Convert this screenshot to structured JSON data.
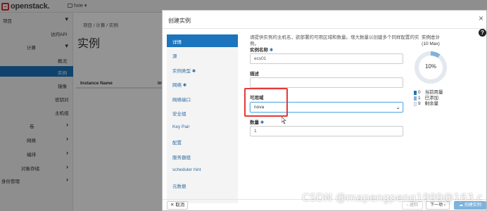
{
  "app": {
    "logo_text": "openstack.",
    "project_selector": "hxie",
    "project_caret": "▾"
  },
  "sidebar": {
    "items": [
      {
        "label": "项目",
        "chev": "▾"
      },
      {
        "label": "访问API"
      },
      {
        "label": "计算",
        "chev": "▾"
      },
      {
        "label": "概况"
      },
      {
        "label": "实例"
      },
      {
        "label": "镜像"
      },
      {
        "label": "密钥对"
      },
      {
        "label": "主机组"
      },
      {
        "label": "卷",
        "chev": "›"
      },
      {
        "label": "网络",
        "chev": "›"
      },
      {
        "label": "编排",
        "chev": "›"
      },
      {
        "label": "对象存储",
        "chev": "›"
      },
      {
        "label": "身份管理",
        "chev": "›"
      }
    ]
  },
  "main": {
    "breadcrumb": "项目 / 计算 / 实例",
    "title": "实例",
    "table_headers": [
      "Instance Name",
      "Ima"
    ]
  },
  "modal": {
    "title": "创建实例",
    "close": "×",
    "help": "?",
    "steps": [
      {
        "label": "详情",
        "req": "",
        "active": true
      },
      {
        "label": "源",
        "req": ""
      },
      {
        "label": "实例类型",
        "req": "✱"
      },
      {
        "label": "网络",
        "req": "✱"
      },
      {
        "label": "网络端口",
        "req": ""
      },
      {
        "label": "安全组",
        "req": ""
      },
      {
        "label": "Key Pair",
        "req": ""
      },
      {
        "label": "配置",
        "req": ""
      },
      {
        "label": "服务器组",
        "req": ""
      },
      {
        "label": "scheduler hint",
        "req": ""
      },
      {
        "label": "元数据",
        "req": ""
      }
    ],
    "form": {
      "description": "请提供实例的主机名，欲部署的可用区域和数量。增大数量以创建多个同样配置的实例。",
      "name_label": "实例名称",
      "name_req": "✱",
      "name_value": "ecs01",
      "desc_label": "描述",
      "desc_value": "",
      "az_label": "可用域",
      "az_value": "nova",
      "az_caret": "⌄",
      "count_label": "数量",
      "count_req": "✱",
      "count_value": "1"
    },
    "quota": {
      "title": "实例总计",
      "subtitle": "(10 Max)",
      "percent_label": "10%",
      "used_fraction": 0.1,
      "legend": [
        {
          "value": "0",
          "label": "当前用量",
          "color": "#1f77b4"
        },
        {
          "value": "1",
          "label": "已添加",
          "color": "#7fb3dd"
        },
        {
          "value": "9",
          "label": "剩余量",
          "color": "#e8eef3"
        }
      ]
    },
    "footer": {
      "cancel": "✕ 取消",
      "back": "‹ 返回",
      "next": "下一项 ›",
      "create": "☁ 创建实例"
    }
  },
  "watermark": "CSDN @mapengpeng1999@163.c"
}
